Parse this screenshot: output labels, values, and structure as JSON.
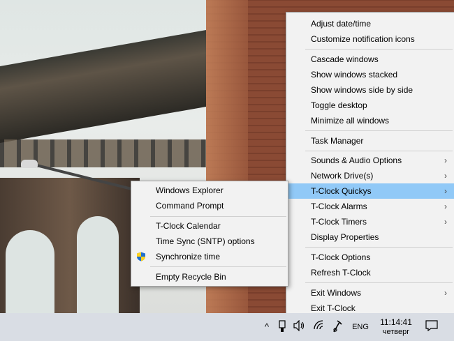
{
  "colors": {
    "highlight": "#91c9f7",
    "menu_bg": "#f2f2f2",
    "taskbar_bg": "#d9dde4"
  },
  "main_menu": {
    "items": [
      {
        "label": "Adjust date/time"
      },
      {
        "label": "Customize notification icons"
      },
      {
        "label": "Cascade windows"
      },
      {
        "label": "Show windows stacked"
      },
      {
        "label": "Show windows side by side"
      },
      {
        "label": "Toggle desktop"
      },
      {
        "label": "Minimize all windows"
      },
      {
        "label": "Task Manager"
      },
      {
        "label": "Sounds & Audio Options",
        "has_submenu": true
      },
      {
        "label": "Network Drive(s)",
        "has_submenu": true
      },
      {
        "label": "T-Clock Quickys",
        "has_submenu": true,
        "highlighted": true
      },
      {
        "label": "T-Clock Alarms",
        "has_submenu": true
      },
      {
        "label": "T-Clock Timers",
        "has_submenu": true
      },
      {
        "label": "Display Properties"
      },
      {
        "label": "T-Clock Options"
      },
      {
        "label": "Refresh T-Clock"
      },
      {
        "label": "Exit Windows",
        "has_submenu": true
      },
      {
        "label": "Exit T-Clock"
      }
    ],
    "arrow_glyph": "›"
  },
  "sub_menu": {
    "items": [
      {
        "label": "Windows Explorer"
      },
      {
        "label": "Command Prompt"
      },
      {
        "label": "T-Clock Calendar"
      },
      {
        "label": "Time Sync (SNTP) options"
      },
      {
        "label": "Synchronize time",
        "icon": "shield-icon"
      },
      {
        "label": "Empty Recycle Bin"
      }
    ]
  },
  "taskbar": {
    "chevron": "^",
    "language": "ENG",
    "time": "11:14:41",
    "day": "четверг",
    "icons": [
      "chevron-up-icon",
      "usb-icon",
      "volume-icon",
      "wifi-icon",
      "t-clock-icon",
      "notification-icon"
    ]
  }
}
